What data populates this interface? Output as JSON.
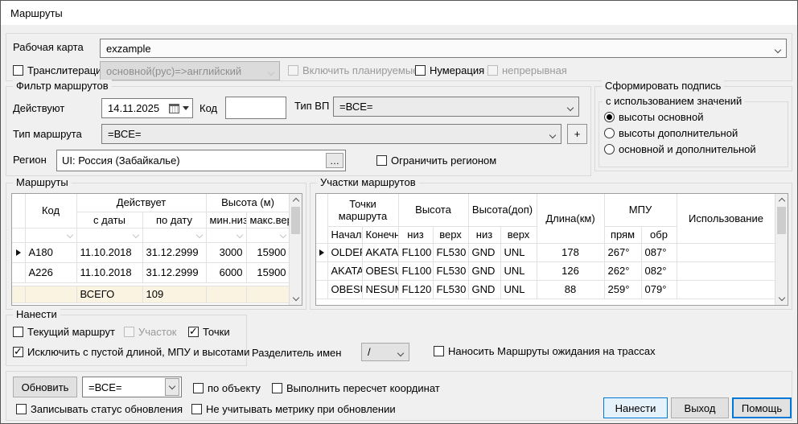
{
  "colors": {
    "accent": "#0078d7",
    "summary_row_bg": "#faf3e1",
    "primary_button_bg": "#e5f1fb"
  },
  "window": {
    "title": "Маршруты"
  },
  "top": {
    "working_map_label": "Рабочая карта",
    "working_map_value": "exzample",
    "transliteration_label": "Транслитерация",
    "transliteration_checked": false,
    "transliteration_value": "основной(рус)=>английский",
    "include_planned_label": "Включить планируемые",
    "include_planned_checked": false,
    "numbering_label": "Нумерация",
    "numbering_checked": false,
    "continuous_label": "непрерывная",
    "continuous_checked": false
  },
  "filter": {
    "group_label": "Фильтр маршрутов",
    "valid_label": "Действуют",
    "valid_date": "14.11.2025",
    "code_label": "Код",
    "code_value": "",
    "vp_type_label": "Тип ВП",
    "vp_type_value": "=ВСЕ=",
    "route_type_label": "Тип маршрута",
    "route_type_value": "=ВСЕ=",
    "add_button": "+",
    "region_label": "Регион",
    "region_value": "UI: Россия (Забайкалье)",
    "region_browse": "…",
    "limit_region_label": "Ограничить регионом",
    "limit_region_checked": false
  },
  "signature": {
    "group_label": "Сформировать подпись",
    "subgroup_label": "с использованием значений",
    "options": [
      {
        "label": "высоты основной",
        "selected": true
      },
      {
        "label": "высоты дополнительной",
        "selected": false
      },
      {
        "label": "основной и дополнительной",
        "selected": false
      }
    ]
  },
  "routes_table": {
    "group_label": "Маршруты",
    "col_code": "Код",
    "col_valid": "Действует",
    "col_from": "с даты",
    "col_to": "по дату",
    "col_height": "Высота (м)",
    "col_min": "мин.низ",
    "col_max": "макс.верх",
    "rows": [
      {
        "code": "А180",
        "from": "11.10.2018",
        "to": "31.12.2999",
        "min": "3000",
        "max": "15900"
      },
      {
        "code": "А226",
        "from": "11.10.2018",
        "to": "31.12.2999",
        "min": "6000",
        "max": "15900"
      }
    ],
    "summary_label": "ВСЕГО",
    "summary_value": "109"
  },
  "segments_table": {
    "group_label": "Участки маршрутов",
    "col_points": "Точки маршрута",
    "col_start": "Начальная",
    "col_end": "Конечная",
    "col_height": "Высота",
    "col_height_add": "Высота(доп)",
    "col_low": "низ",
    "col_high": "верх",
    "col_length": "Длина(км)",
    "col_mpu": "МПУ",
    "col_fwd": "прям",
    "col_back": "обр",
    "col_usage": "Использование",
    "rows": [
      {
        "start": "OLDEP",
        "end": "AKATA",
        "low": "FL100",
        "high": "FL530",
        "low2": "GND",
        "high2": "UNL",
        "length": "178",
        "fwd": "267°",
        "back": "087°",
        "usage": ""
      },
      {
        "start": "AKATA",
        "end": "OBESU",
        "low": "FL100",
        "high": "FL530",
        "low2": "GND",
        "high2": "UNL",
        "length": "126",
        "fwd": "262°",
        "back": "082°",
        "usage": ""
      },
      {
        "start": "OBESU",
        "end": "NESUM",
        "low": "FL120",
        "high": "FL530",
        "low2": "GND",
        "high2": "UNL",
        "length": "88",
        "fwd": "259°",
        "back": "079°",
        "usage": ""
      }
    ]
  },
  "draw": {
    "group_label": "Нанести",
    "current_route_label": "Текущий маршрут",
    "current_route_checked": false,
    "segment_label": "Участок",
    "segment_checked": false,
    "points_label": "Точки",
    "points_checked": true,
    "exclude_label": "Исключить с пустой длиной, МПУ и высотами",
    "exclude_checked": true,
    "separator_label": "Разделитель имен",
    "separator_value": "/",
    "holding_label": "Наносить Маршруты ожидания на трассах",
    "holding_checked": false
  },
  "update": {
    "update_button": "Обновить",
    "scope_value": "=ВСЕ=",
    "by_object_label": "по объекту",
    "by_object_checked": false,
    "recalc_label": "Выполнить пересчет координат",
    "recalc_checked": false,
    "write_status_label": "Записывать статус обновления",
    "write_status_checked": false,
    "ignore_metric_label": "Не учитывать метрику при обновлении",
    "ignore_metric_checked": false
  },
  "footer": {
    "draw_button": "Нанести",
    "exit_button": "Выход",
    "help_button": "Помощь"
  }
}
